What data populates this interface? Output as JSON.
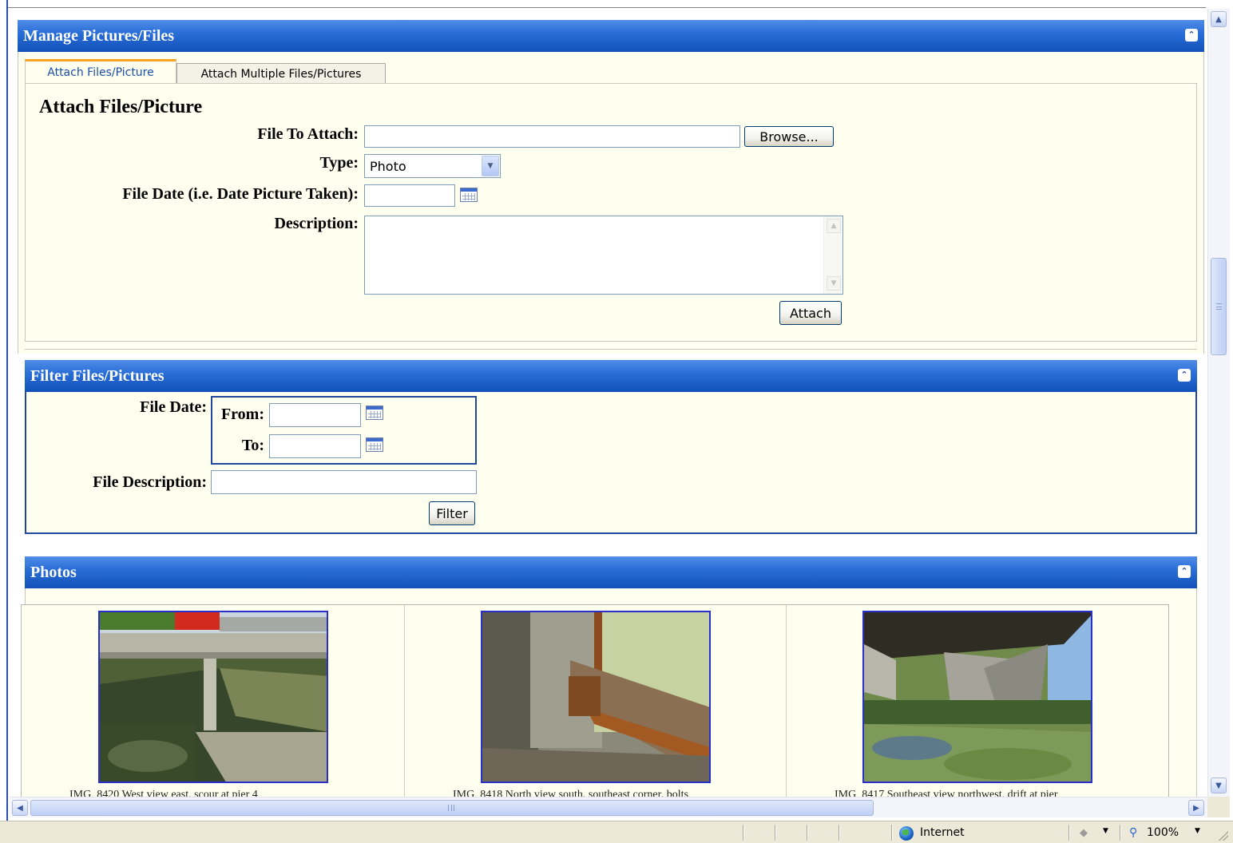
{
  "manage_panel": {
    "title": "Manage Pictures/Files"
  },
  "tabs": [
    {
      "label": "Attach Files/Picture",
      "active": true
    },
    {
      "label": "Attach Multiple Files/Pictures",
      "active": false
    }
  ],
  "attach_form": {
    "heading": "Attach Files/Picture",
    "file_label": "File To Attach:",
    "file_value": "",
    "browse_label": "Browse...",
    "type_label": "Type:",
    "type_value": "Photo",
    "date_label": "File Date (i.e. Date Picture Taken):",
    "date_value": "",
    "description_label": "Description:",
    "description_value": "",
    "attach_label": "Attach"
  },
  "filter_panel": {
    "title": "Filter Files/Pictures",
    "file_date_label": "File Date:",
    "from_label": "From:",
    "from_value": "",
    "to_label": "To:",
    "to_value": "",
    "file_description_label": "File Description:",
    "file_description_value": "",
    "filter_label": "Filter"
  },
  "photos_panel": {
    "title": "Photos",
    "photos": [
      {
        "caption": "IMG_8420 West view east, scour at pier 4"
      },
      {
        "caption": "IMG_8418 North view south, southeast corner, bolts"
      },
      {
        "caption": "IMG_8417 Southeast view northwest, drift at pier"
      }
    ]
  },
  "status_bar": {
    "zone": "Internet",
    "zoom": "100%"
  },
  "colors": {
    "header_blue": "#1250b8",
    "panel_bg": "#fffff0",
    "tab_accent": "#f5a524",
    "photo_border": "#2830c9"
  },
  "icons": [
    "collapse-icon",
    "calendar-icon",
    "chevron-down-icon",
    "globe-icon",
    "shield-icon",
    "zoom-icon"
  ]
}
